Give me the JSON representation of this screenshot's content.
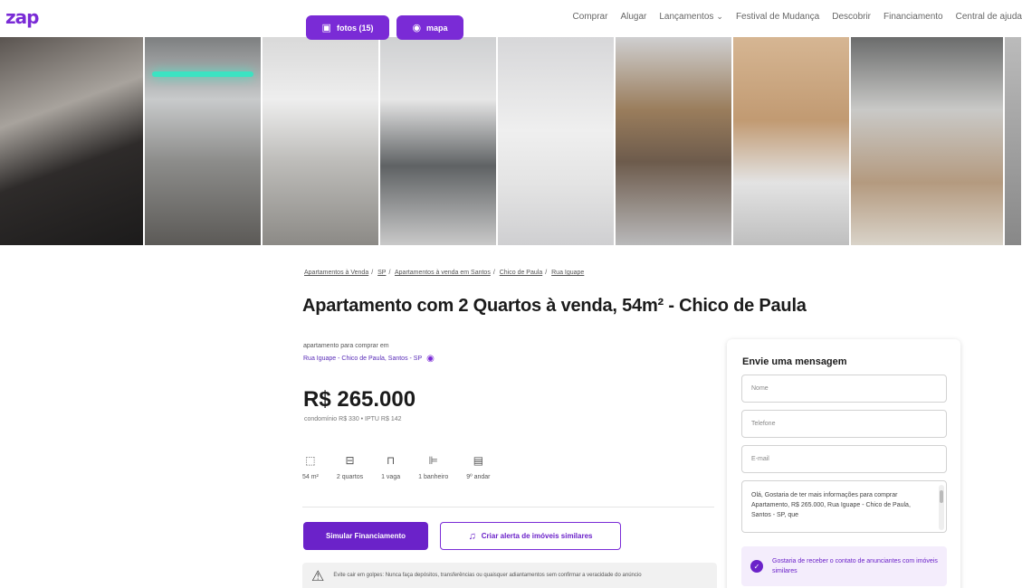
{
  "header": {
    "logo": "zap",
    "nav": [
      {
        "label": "Comprar",
        "has_dropdown": false
      },
      {
        "label": "Alugar",
        "has_dropdown": false
      },
      {
        "label": "Lançamentos",
        "has_dropdown": true
      },
      {
        "label": "Festival de Mudança",
        "has_dropdown": false
      },
      {
        "label": "Descobrir",
        "has_dropdown": false
      },
      {
        "label": "Financiamento",
        "has_dropdown": false
      },
      {
        "label": "Central de ajuda",
        "has_dropdown": false
      }
    ]
  },
  "gallery": {
    "photos_button": "fotos (15)",
    "map_button": "mapa",
    "photo_count": 9
  },
  "breadcrumb": {
    "items": [
      "Apartamentos à Venda",
      "SP",
      "Apartamentos à venda em Santos",
      "Chico de Paula",
      "Rua Iguape"
    ]
  },
  "listing": {
    "title": "Apartamento com 2 Quartos à venda, 54m² - Chico de Paula",
    "subtitle": "apartamento para comprar em",
    "address": "Rua Iguape - Chico de Paula, Santos - SP",
    "price": "R$ 265.000",
    "price_details": "condomínio R$ 330 • IPTU R$ 142",
    "features": [
      {
        "icon": "area-icon",
        "glyph": "⬚",
        "label": "54 m²"
      },
      {
        "icon": "bed-icon",
        "glyph": "⊟",
        "label": "2 quartos"
      },
      {
        "icon": "car-icon",
        "glyph": "⊓",
        "label": "1 vaga"
      },
      {
        "icon": "bath-icon",
        "glyph": "⊫",
        "label": "1 banheiro"
      },
      {
        "icon": "building-icon",
        "glyph": "▤",
        "label": "9º andar"
      }
    ],
    "simulate_button": "Simular Financiamento",
    "alert_button": "Criar alerta de imóveis similares",
    "warning_text": "Evite cair em golpes: Nunca faça depósitos, transferências ou quaisquer adiantamentos sem confirmar a veracidade do anúncio"
  },
  "contact": {
    "title": "Envie uma mensagem",
    "name_placeholder": "Nome",
    "phone_placeholder": "Telefone",
    "email_placeholder": "E-mail",
    "message": "Olá, Gostaria de ter mais informações para comprar Apartamento, R$ 265.000, Rua Iguape - Chico de Paula, Santos - SP, que",
    "consent": "Gostaria de receber o contato de anunciantes com imóveis similares"
  },
  "colors": {
    "brand": "#7a2bd6",
    "primary_button": "#6b22c9",
    "consent_bg": "#f4edfc"
  }
}
